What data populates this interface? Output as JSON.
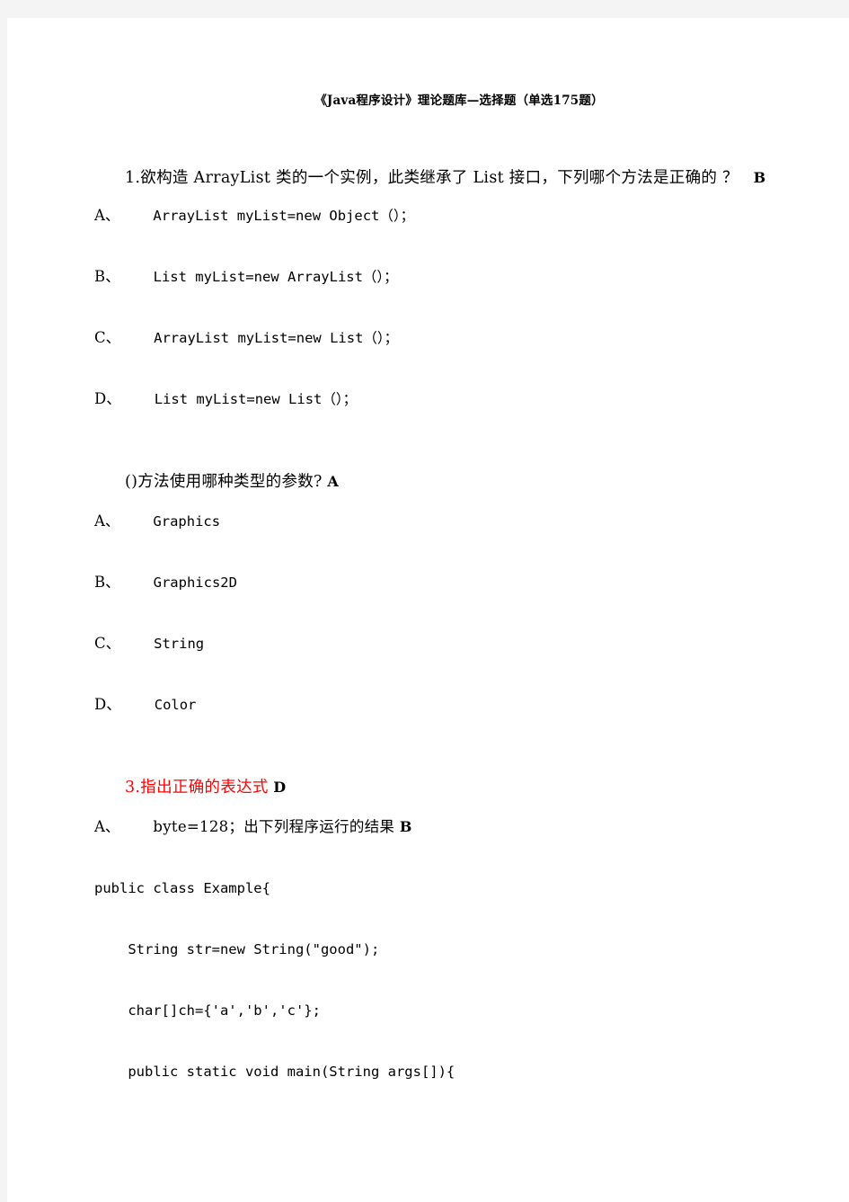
{
  "document": {
    "title": "《Java程序设计》理论题库—选择题（单选175题）",
    "accent_red": "#ff0000",
    "text_color": "#000000",
    "page_background": "#ffffff",
    "canvas_background": "#f4f4f4"
  },
  "questions": [
    {
      "number": "1.",
      "stem": "欲构造 ArrayList 类的一个实例，此类继承了 List 接口，下列哪个方法是正确的 ？",
      "answer": "B",
      "stem_color": "#000000",
      "options": [
        {
          "label": "A、",
          "text": "ArrayList myList=new Object（）；"
        },
        {
          "label": "B、",
          "text": "List myList=new ArrayList（）；"
        },
        {
          "label": "C、",
          "text": "ArrayList myList=new List（）；"
        },
        {
          "label": "D、",
          "text": "List myList=new List（）；"
        }
      ]
    },
    {
      "number": "",
      "stem": "()方法使用哪种类型的参数?",
      "answer": "A",
      "stem_color": "#000000",
      "options": [
        {
          "label": "A、",
          "text": "Graphics"
        },
        {
          "label": "B、",
          "text": "Graphics2D"
        },
        {
          "label": "C、",
          "text": "String"
        },
        {
          "label": "D、",
          "text": "Color"
        }
      ]
    },
    {
      "number": "3.",
      "stem": "指出正确的表达式",
      "answer": "D",
      "stem_color": "#ff0000",
      "options": [
        {
          "label": "A、",
          "text": "byte=128；出下列程序运行的结果",
          "answer": "B"
        }
      ]
    }
  ],
  "code_block": {
    "lines": [
      "public class Example{",
      "    String str=new String(\"good\");",
      "    char[]ch={'a','b','c'};",
      "    public static void main(String args[]){"
    ]
  }
}
